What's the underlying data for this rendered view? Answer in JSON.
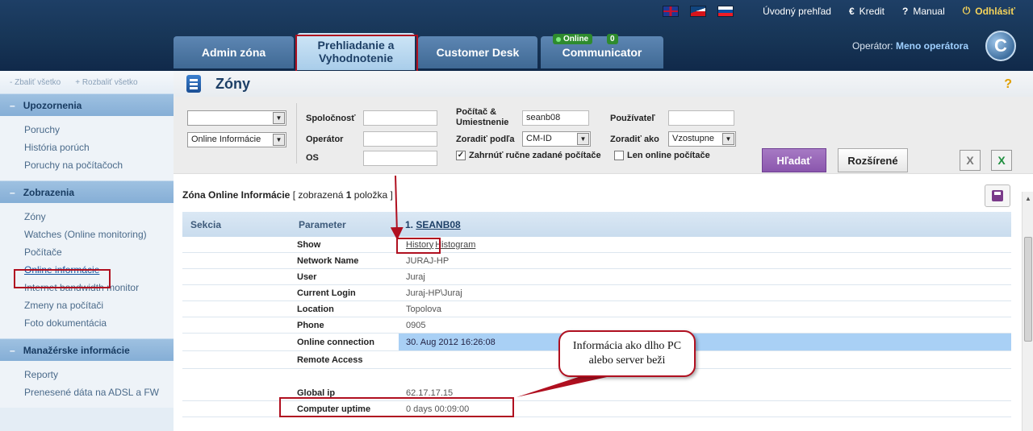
{
  "topbar": {
    "languages": [
      "en-flag",
      "cz-flag",
      "sk-flag"
    ],
    "links": [
      {
        "icon": "",
        "label": "Úvodný prehľad"
      },
      {
        "icon": "€",
        "label": "Kredit"
      },
      {
        "icon": "?",
        "label": "Manual"
      },
      {
        "icon": "⏻",
        "label": "Odhlásiť"
      }
    ]
  },
  "tabs": [
    {
      "label_line1": "Admin zóna",
      "label_line2": ""
    },
    {
      "label_line1": "Prehliadanie a",
      "label_line2": "Vyhodnotenie"
    },
    {
      "label_line1": "Customer Desk",
      "label_line2": ""
    },
    {
      "label_line1": "Communicator",
      "label_line2": ""
    }
  ],
  "communicator": {
    "online_label": "Online",
    "count": "0"
  },
  "operator": {
    "prefix": "Operátor:",
    "name": "Meno operátora"
  },
  "logo": "C",
  "sidebar": {
    "collapse_all": "- Zbaliť všetko",
    "expand_all": "+ Rozbaliť všetko",
    "sections": [
      {
        "title": "Upozornenia",
        "items": [
          "Poruchy",
          "História porúch",
          "Poruchy na počítačoch"
        ]
      },
      {
        "title": "Zobrazenia",
        "items": [
          "Zóny",
          "Watches (Online monitoring)",
          "Počítače",
          "Online informácie",
          "Internet bandwidth monitor",
          "Zmeny na počítači",
          "Foto dokumentácia"
        ]
      },
      {
        "title": "Manažérske informácie",
        "items": [
          "Reporty",
          "Prenesené dáta na ADSL a FW"
        ]
      }
    ]
  },
  "page": {
    "title": "Zóny",
    "help": "?"
  },
  "filters": {
    "select1_value": "",
    "select2_value": "Online Informácie",
    "company_label": "Spoločnosť",
    "operator_label": "Operátor",
    "os_label": "OS",
    "computer_label_1": "Počítač &",
    "computer_label_2": "Umiestnenie",
    "computer_value": "seanb08",
    "sort_by_label": "Zoradiť podľa",
    "sort_by_value": "CM-ID",
    "user_label": "Používateľ",
    "sort_as_label": "Zoradiť ako",
    "sort_as_value": "Vzostupne",
    "include_manual": "Zahrnúť ručne zadané počítače",
    "include_manual_checked": true,
    "online_only": "Len online počítače",
    "online_only_checked": false,
    "search_button": "Hľadať",
    "advanced_button": "Rozšírené"
  },
  "result": {
    "prefix": "Zóna Online Informácie",
    "count_text_before": "[ zobrazená ",
    "count": "1",
    "count_text_after": " položka ]"
  },
  "table": {
    "headers": {
      "section": "Sekcia",
      "parameter": "Parameter",
      "computer_index": "1.",
      "computer_name": "SEANB08"
    },
    "rows": [
      {
        "key": "Show",
        "links": [
          "History",
          "Histogram"
        ]
      },
      {
        "key": "Network Name",
        "value": "JURAJ-HP"
      },
      {
        "key": "User",
        "value": "Juraj"
      },
      {
        "key": "Current Login",
        "value": "Juraj-HP\\Juraj"
      },
      {
        "key": "Location",
        "value": "Topolova"
      },
      {
        "key": "Phone",
        "value": "0905"
      },
      {
        "key": "Online connection",
        "value": "30. Aug 2012 16:26:08"
      },
      {
        "key": "Remote Access",
        "value": ""
      },
      {
        "key": "",
        "value": ""
      },
      {
        "key": "Global ip",
        "value": "62.17.17.15"
      },
      {
        "key": "Computer uptime",
        "value": "0 days 00:09:00"
      }
    ]
  },
  "callout": {
    "line1": "Informácia ako dlho PC",
    "line2": "alebo server beži"
  }
}
